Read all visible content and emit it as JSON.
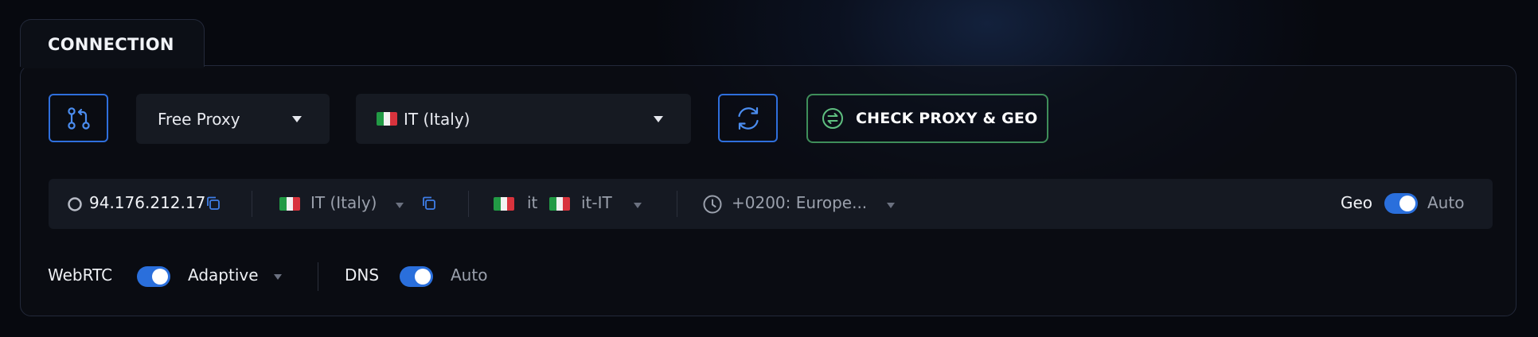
{
  "panel": {
    "title": "CONNECTION"
  },
  "toolbar": {
    "proxy_type": "Free Proxy",
    "country": "IT (Italy)",
    "check_label": "CHECK PROXY & GEO"
  },
  "info": {
    "ip": "94.176.212.17",
    "geo_country": "IT (Italy)",
    "language_short": "it",
    "language_locale": "it-IT",
    "timezone": "+0200: Europe...",
    "geo_label": "Geo",
    "geo_mode": "Auto",
    "geo_enabled": true
  },
  "options": {
    "webrtc_label": "WebRTC",
    "webrtc_enabled": true,
    "webrtc_mode": "Adaptive",
    "dns_label": "DNS",
    "dns_enabled": true,
    "dns_mode": "Auto"
  },
  "colors": {
    "accent_blue": "#2f6fdc",
    "accent_green": "#3f8e5a",
    "panel_border": "#23293a"
  },
  "icons": {
    "swap": "git-compare-icon",
    "refresh": "refresh-icon",
    "check": "arrows-exchange-circle-icon",
    "status": "status-circle-icon",
    "copy": "copy-icon",
    "clock": "clock-icon"
  }
}
